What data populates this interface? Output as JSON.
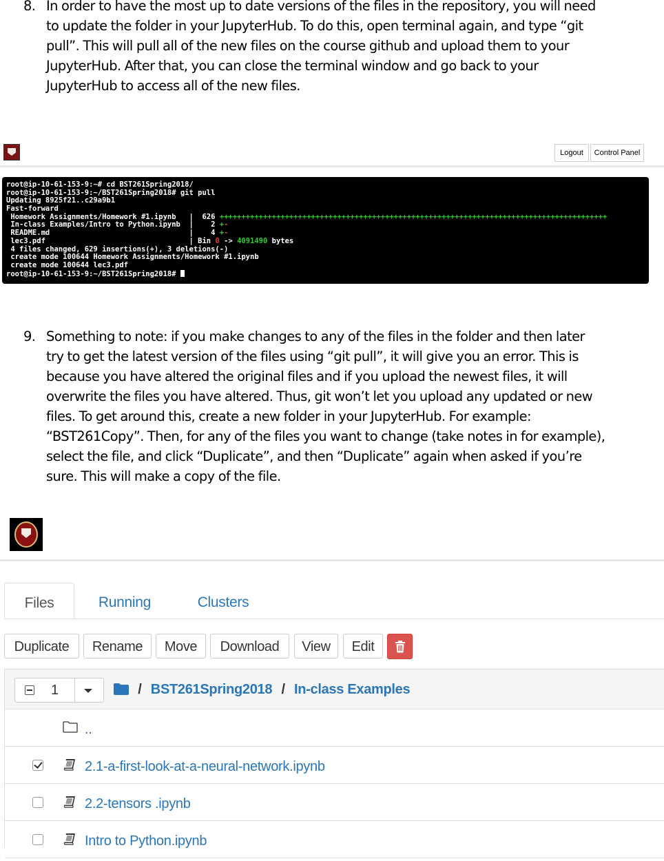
{
  "step8": {
    "number": "8.",
    "text": "In order to have the most up to date versions of the files in the repository, you will need\nto update the folder in your JupyterHub. To do this, open terminal again, and type “git\npull”. This will pull all of the new files on the course github and upload them to your\nJupyterHub. After that, you can close the terminal window and go back to your\nJupyterHub to access all of the new files."
  },
  "terminal_screenshot": {
    "header": {
      "logout_label": "Logout",
      "control_panel_label": "Control Panel"
    },
    "lines": [
      "root@ip-10-61-153-9:~# cd BST261Spring2018/",
      "root@ip-10-61-153-9:~/BST261Spring2018# git pull",
      "Updating 8925f21..c29a9b1",
      "Fast-forward",
      " Homework Assignments/Homework #1.ipynb   |  626 ",
      " In-class Examples/Intro to Python.ipynb  |    2 ",
      " README.md                                |    4 ",
      " lec3.pdf                                 | Bin ",
      " 4 files changed, 629 insertions(+), 3 deletions(-)",
      " create mode 100644 Homework Assignments/Homework #1.ipynb",
      " create mode 100644 lec3.pdf",
      "root@ip-10-61-153-9:~/BST261Spring2018# "
    ],
    "diff_plus_long": "+++++++++++++++++++++++++++++++++++++++++++++++++++++++++++++++++++++++++++++++++++++++++",
    "diff_line2_plus": "+",
    "diff_line2_minus": "-",
    "diff_line3_plus": "+",
    "diff_line3_minus": "-",
    "bin_old": "0",
    "bin_arrow": " -> ",
    "bin_new": "4091490",
    "bin_unit": " bytes"
  },
  "step9": {
    "number": "9.",
    "text": "Something to note: if you make changes to any of the files in the folder and then later\ntry to get the latest version of the files using “git pull”, it will give you an error. This is\nbecause you have altered the original files and if you upload the newest files, it will\noverwrite the files you have altered. Thus, git won’t let you upload any updated or new\nfiles. To get around this, create a new folder in your JupyterHub. For example:\n“BST261Copy”. Then, for any of the files you want to change (take notes in for example),\nselect the file, and click “Duplicate”, and then “Duplicate” again when asked if you’re\nsure. This will make a copy of the file."
  },
  "jupyter_screenshot": {
    "tabs": [
      "Files",
      "Running",
      "Clusters"
    ],
    "toolbar": [
      "Duplicate",
      "Rename",
      "Move",
      "Download",
      "View",
      "Edit"
    ],
    "selected_count": "1",
    "breadcrumb": [
      "/",
      "BST261Spring2018",
      "/",
      "In-class Examples"
    ],
    "parent_dir": "..",
    "files": [
      {
        "name": "2.1-a-first-look-at-a-neural-network.ipynb",
        "checked": true
      },
      {
        "name": "2.2-tensors .ipynb",
        "checked": false
      },
      {
        "name": "Intro to Python.ipynb",
        "checked": false
      }
    ]
  }
}
